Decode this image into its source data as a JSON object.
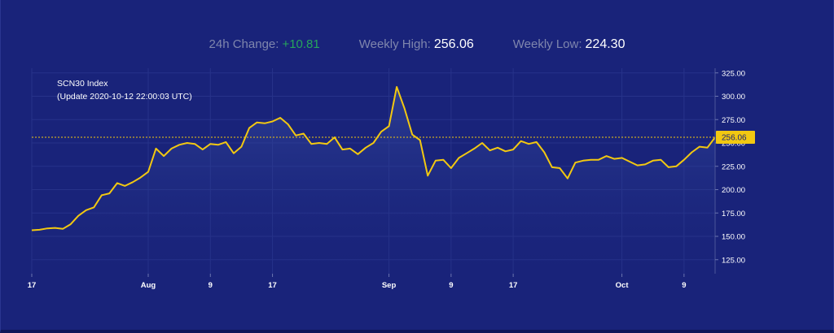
{
  "stats": {
    "change_label": "24h Change:",
    "change_value": "+10.81",
    "high_label": "Weekly High:",
    "high_value": "256.06",
    "low_label": "Weekly Low:",
    "low_value": "224.30"
  },
  "colors": {
    "background": "#19237a",
    "line": "#f2c811",
    "positive": "#26a65b",
    "muted_text": "#7f86ad",
    "grid": "#27338a"
  },
  "chart_data": {
    "type": "area",
    "title": "SCN30 Index",
    "subtitle": "(Update 2020-10-12 22:00:03 UTC)",
    "xlabel": "",
    "ylabel": "",
    "x_start": "2020-07-17",
    "x_ticks": [
      {
        "label": "17",
        "date": "2020-07-17"
      },
      {
        "label": "Aug",
        "date": "2020-08-01"
      },
      {
        "label": "9",
        "date": "2020-08-09"
      },
      {
        "label": "17",
        "date": "2020-08-17"
      },
      {
        "label": "Sep",
        "date": "2020-09-01"
      },
      {
        "label": "9",
        "date": "2020-09-09"
      },
      {
        "label": "17",
        "date": "2020-09-17"
      },
      {
        "label": "Oct",
        "date": "2020-10-01"
      },
      {
        "label": "9",
        "date": "2020-10-09"
      }
    ],
    "y_ticks": [
      "125.00",
      "150.00",
      "175.00",
      "200.00",
      "225.00",
      "250.00",
      "275.00",
      "300.00",
      "325.00"
    ],
    "ylim": [
      110,
      330
    ],
    "current_value": 256.06,
    "current_label": "256.06",
    "grid": true,
    "series": [
      {
        "values": [
          156.5,
          157,
          158.5,
          159,
          158,
          163,
          172,
          178,
          181,
          194,
          196,
          207,
          204,
          208,
          213,
          219,
          244,
          236,
          244,
          248,
          250,
          249,
          243,
          249,
          248,
          251,
          239,
          246,
          266,
          272,
          271,
          273,
          277,
          270,
          258,
          260,
          249,
          250,
          249,
          256,
          243,
          244,
          238,
          245,
          250,
          262,
          268,
          310,
          287,
          259,
          253,
          215,
          231,
          232,
          223,
          234,
          239,
          244,
          250,
          242,
          245,
          241,
          243,
          252,
          249,
          251,
          240,
          224,
          223,
          212,
          229,
          231,
          232,
          232,
          236,
          233,
          234,
          230,
          226,
          227,
          231,
          232,
          224,
          225,
          232,
          240,
          246,
          245,
          256
        ]
      }
    ]
  }
}
